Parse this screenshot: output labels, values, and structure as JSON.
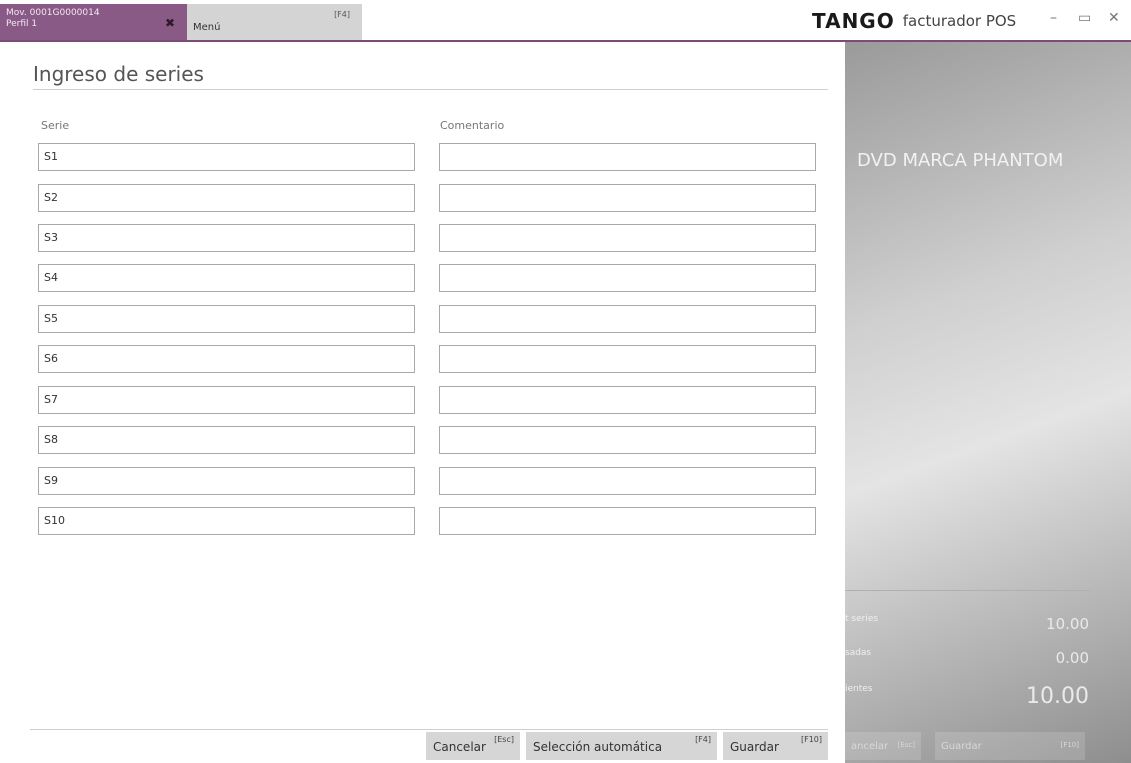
{
  "window": {
    "tabs": [
      {
        "label_line1": "Mov. 0001G0000014",
        "label_line2": "Perfil 1",
        "close": "✖"
      },
      {
        "label": "Menú",
        "shortcut": "[F4]"
      }
    ],
    "brand_logo": "TANGO",
    "brand_sub": "facturador POS",
    "controls": {
      "minimize": "–",
      "maximize": "▭",
      "close": "✕"
    }
  },
  "page": {
    "title": "Ingreso de series",
    "columns": {
      "serie": "Serie",
      "comentario": "Comentario"
    },
    "rows": [
      {
        "serie": "S1",
        "comentario": ""
      },
      {
        "serie": "S2",
        "comentario": ""
      },
      {
        "serie": "S3",
        "comentario": ""
      },
      {
        "serie": "S4",
        "comentario": ""
      },
      {
        "serie": "S5",
        "comentario": ""
      },
      {
        "serie": "S6",
        "comentario": ""
      },
      {
        "serie": "S7",
        "comentario": ""
      },
      {
        "serie": "S8",
        "comentario": ""
      },
      {
        "serie": "S9",
        "comentario": ""
      },
      {
        "serie": "S10",
        "comentario": ""
      }
    ]
  },
  "buttons": {
    "cancel": {
      "label": "Cancelar",
      "key": "[Esc]"
    },
    "auto": {
      "label": "Selección automática",
      "key": "[F4]"
    },
    "save": {
      "label": "Guardar",
      "key": "[F10]"
    }
  },
  "side": {
    "product": "DVD MARCA PHANTOM",
    "summary": [
      {
        "label": "t series",
        "value": "10.00"
      },
      {
        "label": "sadas",
        "value": "0.00"
      },
      {
        "label": "ientes",
        "value": "10.00"
      }
    ],
    "btn1": "ancelar",
    "btn1_key": "[Esc]",
    "btn2": "Guardar",
    "btn2_key": "[F10]"
  },
  "colors": {
    "accent": "#8a5a86",
    "button_bg": "#d6d6d6"
  }
}
